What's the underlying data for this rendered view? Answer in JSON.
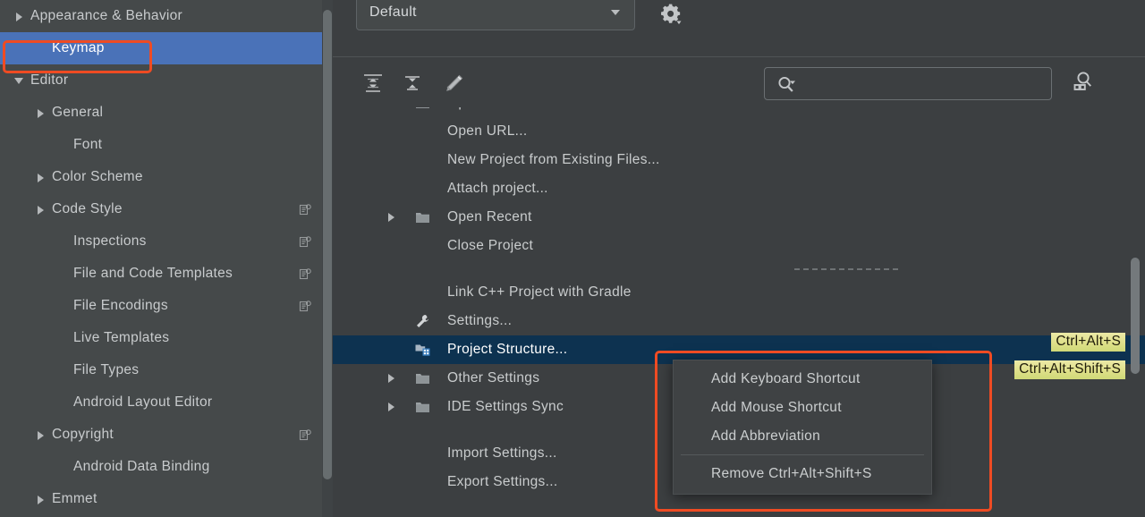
{
  "theme": {
    "sidebar_bg": "#45494a",
    "panel_bg": "#3c3f41",
    "sidebar_selection": "#4a72b8",
    "tree_selection": "#0d3250",
    "annotation_red": "#ef4b23",
    "shortcut_chip_yellow": "#dfe08a",
    "text": "#c8cbcd"
  },
  "sidebar": {
    "items": [
      {
        "label": "Appearance & Behavior",
        "arrow": "collapsed",
        "indent": 0,
        "selected": false,
        "config_icon": false
      },
      {
        "label": "Keymap",
        "arrow": "none",
        "indent": 1,
        "selected": true,
        "config_icon": false
      },
      {
        "label": "Editor",
        "arrow": "expanded",
        "indent": 0,
        "selected": false,
        "config_icon": false
      },
      {
        "label": "General",
        "arrow": "collapsed",
        "indent": 1,
        "selected": false,
        "config_icon": false
      },
      {
        "label": "Font",
        "arrow": "none",
        "indent": 2,
        "selected": false,
        "config_icon": false
      },
      {
        "label": "Color Scheme",
        "arrow": "collapsed",
        "indent": 1,
        "selected": false,
        "config_icon": false
      },
      {
        "label": "Code Style",
        "arrow": "collapsed",
        "indent": 1,
        "selected": false,
        "config_icon": true
      },
      {
        "label": "Inspections",
        "arrow": "none",
        "indent": 2,
        "selected": false,
        "config_icon": true
      },
      {
        "label": "File and Code Templates",
        "arrow": "none",
        "indent": 2,
        "selected": false,
        "config_icon": true
      },
      {
        "label": "File Encodings",
        "arrow": "none",
        "indent": 2,
        "selected": false,
        "config_icon": true
      },
      {
        "label": "Live Templates",
        "arrow": "none",
        "indent": 2,
        "selected": false,
        "config_icon": false
      },
      {
        "label": "File Types",
        "arrow": "none",
        "indent": 2,
        "selected": false,
        "config_icon": false
      },
      {
        "label": "Android Layout Editor",
        "arrow": "none",
        "indent": 2,
        "selected": false,
        "config_icon": false
      },
      {
        "label": "Copyright",
        "arrow": "collapsed",
        "indent": 1,
        "selected": false,
        "config_icon": true
      },
      {
        "label": "Android Data Binding",
        "arrow": "none",
        "indent": 2,
        "selected": false,
        "config_icon": false
      },
      {
        "label": "Emmet",
        "arrow": "collapsed",
        "indent": 1,
        "selected": false,
        "config_icon": false
      }
    ]
  },
  "keymap_panel": {
    "scheme_label": "Default",
    "scheme_icon": "chevron-down-icon",
    "gear_icon": "gear-dropdown-icon",
    "toolbar": {
      "expand_all_icon": "expand-all-icon",
      "collapse_all_icon": "collapse-all-icon",
      "edit_icon": "pencil-edit-icon"
    },
    "search": {
      "value": "",
      "placeholder": "",
      "icon": "search-icon"
    },
    "find_by_shortcut_icon": "find-actions-by-shortcut-icon"
  },
  "action_tree": {
    "rows": [
      {
        "label": "Open...",
        "kind": "action",
        "arrow": false,
        "icon": "folder-open-icon",
        "selected": false,
        "clipped": true
      },
      {
        "label": "Open URL...",
        "kind": "action",
        "arrow": false,
        "icon": "none",
        "selected": false
      },
      {
        "label": "New Project from Existing Files...",
        "kind": "action",
        "arrow": false,
        "icon": "none",
        "selected": false
      },
      {
        "label": "Attach project...",
        "kind": "action",
        "arrow": false,
        "icon": "none",
        "selected": false
      },
      {
        "label": "Open Recent",
        "kind": "group",
        "arrow": true,
        "icon": "folder-icon",
        "selected": false
      },
      {
        "label": "Close Project",
        "kind": "action",
        "arrow": false,
        "icon": "none",
        "selected": false
      },
      {
        "label": "",
        "kind": "separator"
      },
      {
        "label": "Link C++ Project with Gradle",
        "kind": "action",
        "arrow": false,
        "icon": "none",
        "selected": false
      },
      {
        "label": "Settings...",
        "kind": "action",
        "arrow": false,
        "icon": "wrench-icon",
        "selected": false
      },
      {
        "label": "Project Structure...",
        "kind": "action",
        "arrow": false,
        "icon": "project-structure-icon",
        "selected": true
      },
      {
        "label": "Other Settings",
        "kind": "group",
        "arrow": true,
        "icon": "folder-icon",
        "selected": false
      },
      {
        "label": "IDE Settings Sync",
        "kind": "group",
        "arrow": true,
        "icon": "folder-icon",
        "selected": false
      },
      {
        "label": "",
        "kind": "separator"
      },
      {
        "label": "Import Settings...",
        "kind": "action",
        "arrow": false,
        "icon": "none",
        "selected": false
      },
      {
        "label": "Export Settings...",
        "kind": "action",
        "arrow": false,
        "icon": "none",
        "selected": false,
        "clipped": true
      }
    ],
    "shortcuts": [
      {
        "text": "Ctrl+Alt+S",
        "row": "Settings..."
      },
      {
        "text": "Ctrl+Alt+Shift+S",
        "row": "Project Structure..."
      }
    ]
  },
  "context_menu": {
    "items": [
      {
        "label": "Add Keyboard Shortcut",
        "type": "item"
      },
      {
        "label": "Add Mouse Shortcut",
        "type": "item"
      },
      {
        "label": "Add Abbreviation",
        "type": "item"
      },
      {
        "label": "",
        "type": "divider"
      },
      {
        "label": "Remove Ctrl+Alt+Shift+S",
        "type": "item"
      }
    ]
  }
}
